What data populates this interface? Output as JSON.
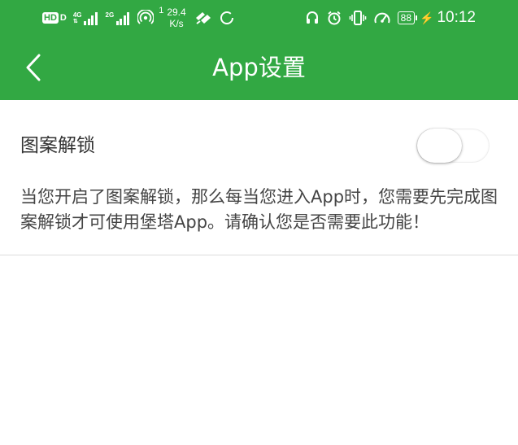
{
  "status_bar": {
    "hd": "HD",
    "hd_suffix": "D",
    "sim1_gen": "4G",
    "sim2_gen": "2G",
    "hotspot_count": "1",
    "speed_value": "29.4",
    "speed_unit": "K/s",
    "battery": "88",
    "time": "10:12",
    "icons": [
      "hd-icon",
      "signal-4g-icon",
      "signal-2g-icon",
      "hotspot-icon",
      "cast-icon",
      "sync-icon",
      "headset-icon",
      "alarm-icon",
      "vibrate-icon",
      "speedometer-icon",
      "battery-icon",
      "charging-icon"
    ]
  },
  "nav": {
    "title": "App设置",
    "back_icon": "chevron-left-icon"
  },
  "settings": {
    "pattern_lock": {
      "label": "图案解锁",
      "enabled": false,
      "description": "当您开启了图案解锁，那么每当您进入App时，您需要先完成图案解锁才可使用堡塔App。请确认您是否需要此功能！"
    }
  },
  "colors": {
    "header_bg": "#32a843",
    "header_text": "#ffffff",
    "page_bg": "#ffffff",
    "divider": "#dcdcdc"
  }
}
